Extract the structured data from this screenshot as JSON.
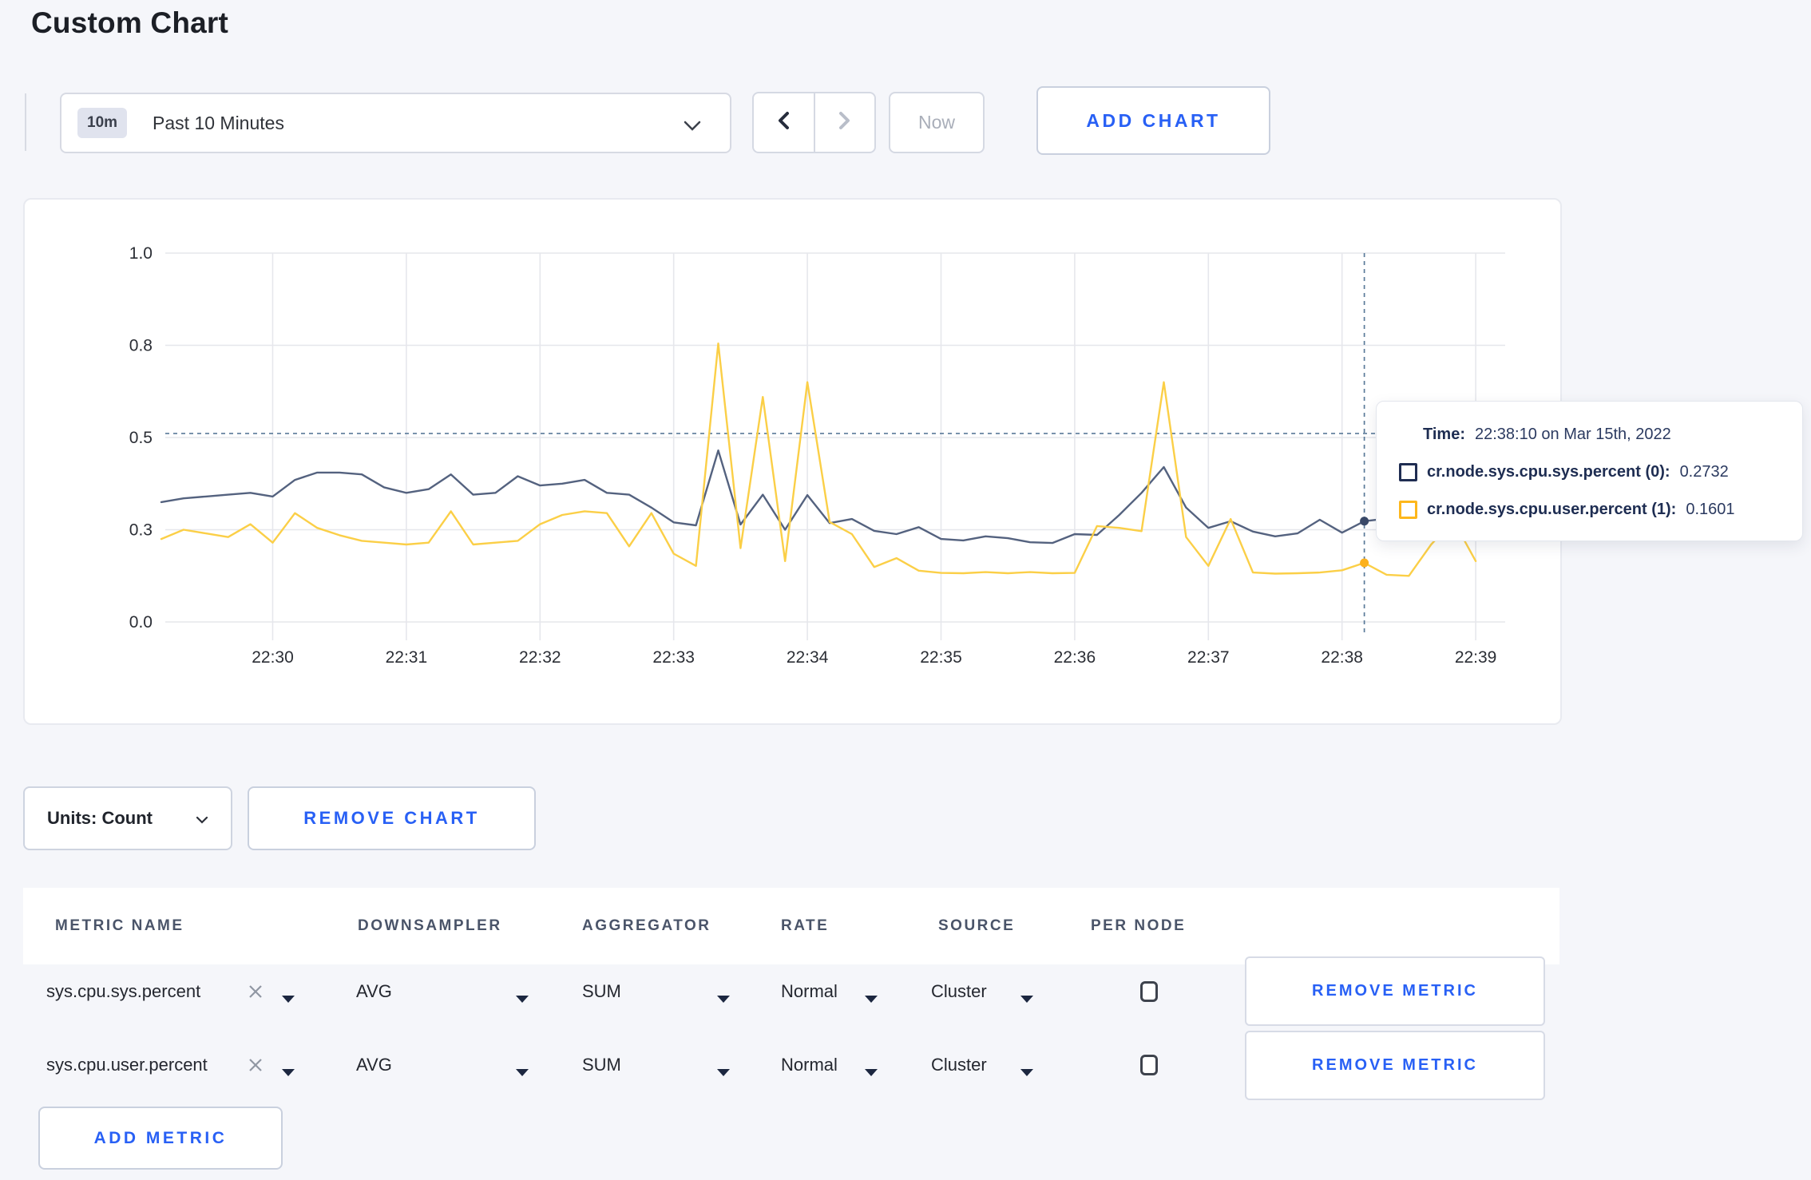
{
  "page": {
    "title": "Custom Chart"
  },
  "toolbar": {
    "time_window": {
      "badge": "10m",
      "label": "Past 10 Minutes"
    },
    "now_label": "Now",
    "add_chart_label": "ADD CHART"
  },
  "chart_controls": {
    "units_label": "Units: Count",
    "remove_chart_label": "REMOVE CHART",
    "add_metric_label": "ADD METRIC"
  },
  "tooltip": {
    "time_label": "Time:",
    "time_value": "22:38:10 on Mar 15th, 2022",
    "rows": [
      {
        "label": "cr.node.sys.cpu.sys.percent (0):",
        "value": "0.2732",
        "color": "#1f2d52"
      },
      {
        "label": "cr.node.sys.cpu.user.percent (1):",
        "value": "0.1601",
        "color": "#fdb71c"
      }
    ]
  },
  "table": {
    "headers": [
      "METRIC NAME",
      "DOWNSAMPLER",
      "AGGREGATOR",
      "RATE",
      "SOURCE",
      "PER NODE"
    ],
    "rows": [
      {
        "metric": "sys.cpu.sys.percent",
        "downsampler": "AVG",
        "aggregator": "SUM",
        "rate": "Normal",
        "source": "Cluster",
        "per_node_checked": false,
        "remove_label": "REMOVE METRIC"
      },
      {
        "metric": "sys.cpu.user.percent",
        "downsampler": "AVG",
        "aggregator": "SUM",
        "rate": "Normal",
        "source": "Cluster",
        "per_node_checked": false,
        "remove_label": "REMOVE METRIC"
      }
    ]
  },
  "chart_data": {
    "type": "line",
    "title": "",
    "xlabel": "",
    "ylabel": "",
    "ylim": [
      0,
      1
    ],
    "grid": true,
    "legend_position": "tooltip-only",
    "x_tick_labels": [
      "22:30",
      "22:31",
      "22:32",
      "22:33",
      "22:34",
      "22:35",
      "22:36",
      "22:37",
      "22:38",
      "22:39"
    ],
    "y_ticks": [
      {
        "value": 0.0,
        "label": "0.0"
      },
      {
        "value": 0.25,
        "label": "0.3"
      },
      {
        "value": 0.5,
        "label": "0.5"
      },
      {
        "value": 0.75,
        "label": "0.8"
      },
      {
        "value": 1.0,
        "label": "1.0"
      }
    ],
    "interval_sec": 10,
    "first_point_offset_sec": -50,
    "series": [
      {
        "name": "cr.node.sys.cpu.sys.percent",
        "color": "#54627f",
        "dot_color": "#3a4968",
        "values": [
          0.325,
          0.335,
          0.34,
          0.345,
          0.35,
          0.34,
          0.385,
          0.405,
          0.405,
          0.4,
          0.365,
          0.35,
          0.36,
          0.4,
          0.345,
          0.35,
          0.395,
          0.37,
          0.375,
          0.385,
          0.35,
          0.345,
          0.31,
          0.27,
          0.262,
          0.465,
          0.264,
          0.345,
          0.25,
          0.344,
          0.268,
          0.279,
          0.247,
          0.238,
          0.257,
          0.225,
          0.221,
          0.232,
          0.227,
          0.216,
          0.214,
          0.238,
          0.236,
          0.29,
          0.35,
          0.42,
          0.31,
          0.255,
          0.273,
          0.245,
          0.232,
          0.24,
          0.277,
          0.242,
          0.2732,
          0.28,
          0.3,
          0.31,
          0.3,
          0.315
        ]
      },
      {
        "name": "cr.node.sys.cpu.user.percent",
        "color": "#fbcf47",
        "dot_color": "#fcb11d",
        "values": [
          0.225,
          0.25,
          0.24,
          0.23,
          0.265,
          0.215,
          0.295,
          0.255,
          0.235,
          0.22,
          0.215,
          0.21,
          0.215,
          0.3,
          0.21,
          0.215,
          0.22,
          0.265,
          0.29,
          0.3,
          0.295,
          0.205,
          0.295,
          0.185,
          0.152,
          0.755,
          0.2,
          0.61,
          0.165,
          0.65,
          0.271,
          0.238,
          0.149,
          0.173,
          0.139,
          0.133,
          0.132,
          0.135,
          0.132,
          0.135,
          0.132,
          0.133,
          0.26,
          0.255,
          0.246,
          0.65,
          0.23,
          0.152,
          0.279,
          0.134,
          0.131,
          0.132,
          0.134,
          0.14,
          0.1601,
          0.128,
          0.125,
          0.21,
          0.275,
          0.165
        ]
      }
    ],
    "hover": {
      "index": 54,
      "time": "22:38:10",
      "crosshair_value": 0.511,
      "values": [
        0.2732,
        0.1601
      ]
    }
  }
}
